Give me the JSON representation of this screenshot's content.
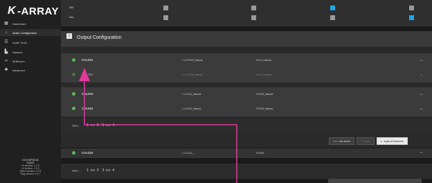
{
  "brand": {
    "logo_k": "K",
    "logo_text": "-ARRAY"
  },
  "sidebar": {
    "items": [
      {
        "label": "Dashboard",
        "icon": "grid-icon"
      },
      {
        "label": "Audio Configuration",
        "icon": "music-note-icon"
      },
      {
        "label": "Audio Tools",
        "icon": "sliders-icon"
      },
      {
        "label": "Network",
        "icon": "network-icon"
      },
      {
        "label": "Multiroom",
        "icon": "link-icon"
      },
      {
        "label": "Advanced",
        "icon": "gear-icon"
      }
    ],
    "device": {
      "name": "K0025P0016",
      "model": "KA02I",
      "version_lines": [
        "UI version: 1.2.2",
        "UI version: 1.1.5",
        "Micro version: 1.0.5",
        "Flag version: 3.0.7"
      ]
    }
  },
  "matrix": {
    "rows": [
      {
        "label": "IN3",
        "states": [
          "off",
          "off",
          "on",
          "off"
        ]
      },
      {
        "label": "IN4",
        "states": [
          "off",
          "off",
          "off",
          "on"
        ]
      }
    ]
  },
  "output_config": {
    "title": "Output Configuration",
    "channels": [
      {
        "name": "CHL001",
        "col1": "1 x KTR25_Natural",
        "col2": "KZ14_Natural",
        "dim": false
      },
      {
        "name": "CHL002",
        "col1": "1 x KTR25_Natural",
        "col2": "KZ14_Natural",
        "dim": true
      },
      {
        "name": "CHL003",
        "col1": "1 x KZ14_Natural",
        "col2": "KTR25_Natural",
        "dim": false
      },
      {
        "name": "CHL004",
        "col1": "1 x KZ14_Natural",
        "col2": "KTR25_Natural",
        "dim": false
      }
    ],
    "ptbl_label": "PBTL",
    "ptbl_values": {
      "a": "1 ",
      "b": "oo",
      "c": " 2  3 oo 4"
    },
    "buttons": {
      "link": "Link amber",
      "copy": "Copy",
      "apply": "Apply all channels"
    },
    "repeat_row": {
      "name": "CHL004",
      "col1": "1 x KZ14_...",
      "col2": "KTR25..."
    },
    "ptbl2_values": "1 oo 2  3 oo 4"
  },
  "colors": {
    "accent": "#1ea7e8",
    "ok": "#5ab85a",
    "annotation": "#e0399b"
  }
}
